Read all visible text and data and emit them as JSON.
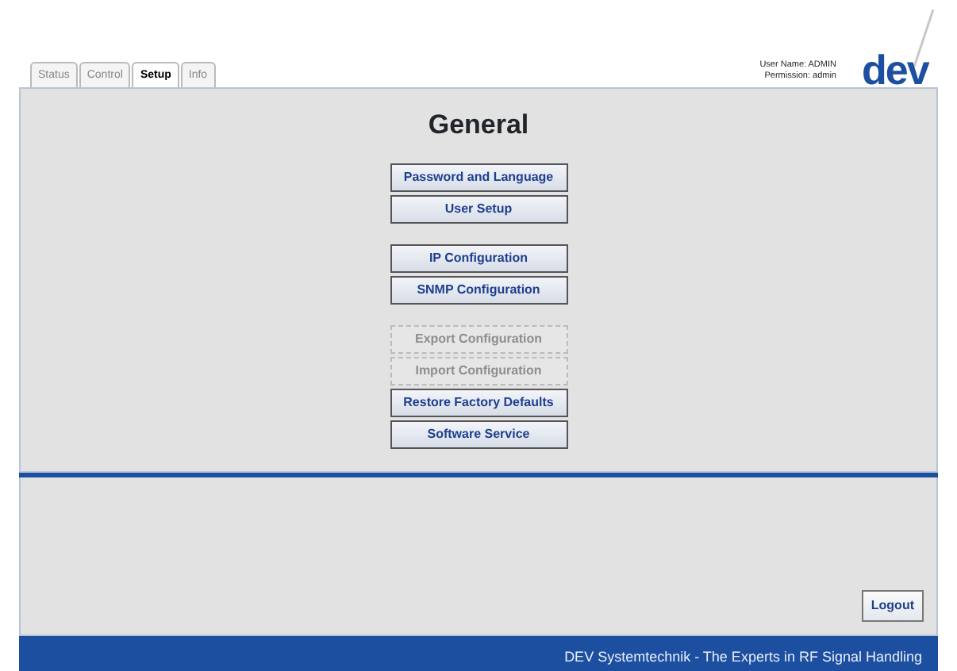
{
  "tabs": [
    {
      "label": "Status",
      "selected": false
    },
    {
      "label": "Control",
      "selected": false
    },
    {
      "label": "Setup",
      "selected": true
    },
    {
      "label": "Info",
      "selected": false
    }
  ],
  "user": {
    "name_line": "User Name: ADMIN",
    "permission_line": "Permission: admin"
  },
  "logo": {
    "text": "dev"
  },
  "heading": "General",
  "button_groups": [
    [
      {
        "label": "Password and Language",
        "disabled": false
      },
      {
        "label": "User Setup",
        "disabled": false
      }
    ],
    [
      {
        "label": "IP Configuration",
        "disabled": false
      },
      {
        "label": "SNMP Configuration",
        "disabled": false
      }
    ],
    [
      {
        "label": "Export Configuration",
        "disabled": true
      },
      {
        "label": "Import Configuration",
        "disabled": true
      },
      {
        "label": "Restore Factory Defaults",
        "disabled": false
      },
      {
        "label": "Software Service",
        "disabled": false
      }
    ]
  ],
  "logout": "Logout",
  "footer": "DEV Systemtechnik - The Experts in RF Signal Handling"
}
